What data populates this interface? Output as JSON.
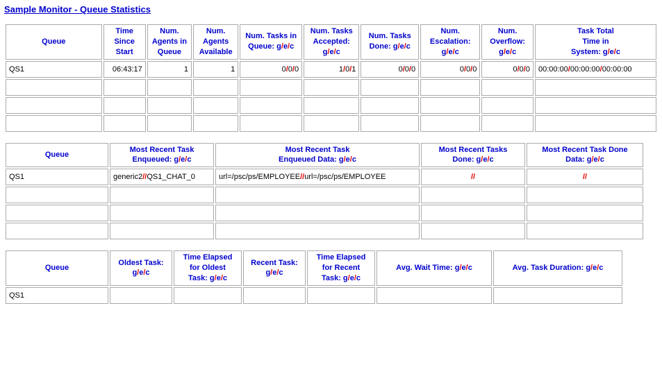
{
  "title": "Sample Monitor - Queue Statistics",
  "sep": "/",
  "dbl": "//",
  "table1": {
    "headers": {
      "queue": "Queue",
      "time_since_start": "Time\nSince\nStart",
      "agents_in_queue": "Num.\nAgents in\nQueue",
      "agents_avail": "Num.\nAgents\nAvailable",
      "tasks_in_queue": "Num. Tasks in\nQueue: g/e/c",
      "tasks_accepted": "Num. Tasks\nAccepted:\ng/e/c",
      "tasks_done": "Num. Tasks\nDone: g/e/c",
      "escalation": "Num.\nEscalation:\ng/e/c",
      "overflow": "Num.\nOverflow:\ng/e/c",
      "task_total": "Task Total\nTime in\nSystem: g/e/c"
    },
    "row": {
      "queue": "QS1",
      "time_since_start": "06:43:17",
      "agents_in_queue": "1",
      "agents_avail": "1",
      "tasks_in_queue": {
        "g": "0",
        "e": "0",
        "c": "0"
      },
      "tasks_accepted": {
        "g": "1",
        "e": "0",
        "c": "1"
      },
      "tasks_done": {
        "g": "0",
        "e": "0",
        "c": "0"
      },
      "escalation": {
        "g": "0",
        "e": "0",
        "c": "0"
      },
      "overflow": {
        "g": "0",
        "e": "0",
        "c": "0"
      },
      "task_total": {
        "g": "00:00:00",
        "e": "00:00:00",
        "c": "00:00:00"
      }
    }
  },
  "table2": {
    "headers": {
      "queue": "Queue",
      "mr_enq": "Most Recent Task\nEnqueued: g/e/c",
      "mr_enq_data": "Most Recent Task\nEnqueued Data: g/e/c",
      "mr_done": "Most Recent Tasks\nDone: g/e/c",
      "mr_done_data": "Most Recent Task Done\nData: g/e/c"
    },
    "row": {
      "queue": "QS1",
      "mr_enq": {
        "g": "generic2",
        "c": "QS1_CHAT_0"
      },
      "mr_enq_data": {
        "g": "url=/psc/ps/EMPLOYEE",
        "c": "url=/psc/ps/EMPLOYEE"
      }
    }
  },
  "table3": {
    "headers": {
      "queue": "Queue",
      "oldest": "Oldest Task:\ng/e/c",
      "elapsed_oldest": "Time Elapsed\nfor Oldest\nTask: g/e/c",
      "recent": "Recent Task:\ng/e/c",
      "elapsed_recent": "Time Elapsed\nfor Recent\nTask: g/e/c",
      "avg_wait": "Avg. Wait Time: g/e/c",
      "avg_dur": "Avg. Task Duration: g/e/c"
    },
    "row": {
      "queue": "QS1"
    }
  }
}
